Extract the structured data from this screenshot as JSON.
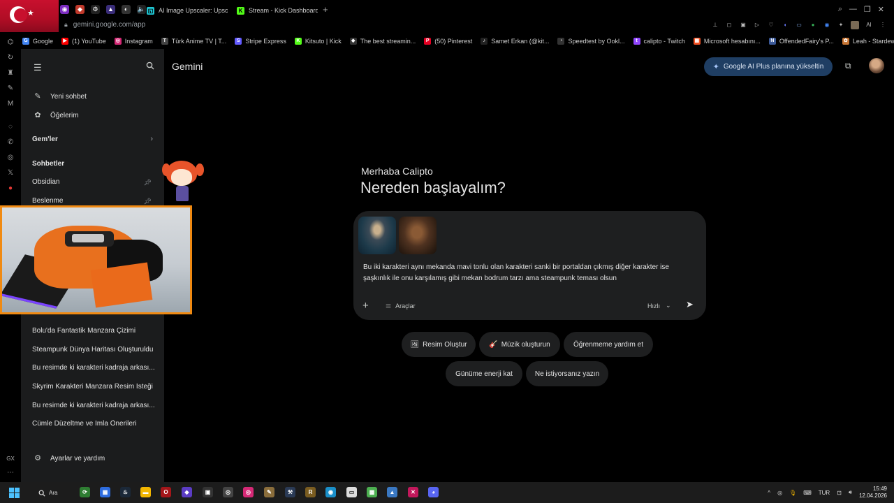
{
  "browser": {
    "tabs": [
      {
        "label": "AI Image Upscaler: Upsca",
        "color": "#1fc7d4"
      },
      {
        "label": "Stream - Kick Dashboard",
        "color": "#53fc18"
      }
    ],
    "url": "gemini.google.com/app",
    "bookmarks": [
      {
        "label": "Google",
        "icon": "G",
        "color": "#4285f4"
      },
      {
        "label": "(1) YouTube",
        "icon": "▶",
        "color": "#ff0000"
      },
      {
        "label": "Instagram",
        "icon": "◎",
        "color": "#d62976"
      },
      {
        "label": "Türk Anime TV | T...",
        "icon": "T",
        "color": "#444444"
      },
      {
        "label": "Stripe Express",
        "icon": "S",
        "color": "#635bff"
      },
      {
        "label": "Kitsuto | Kick",
        "icon": "K",
        "color": "#53fc18"
      },
      {
        "label": "The best streamin...",
        "icon": "◆",
        "color": "#333333"
      },
      {
        "label": "(50) Pinterest",
        "icon": "P",
        "color": "#e60023"
      },
      {
        "label": "Samet Erkan (@kit...",
        "icon": "♪",
        "color": "#222222"
      },
      {
        "label": "Speedtest by Ookl...",
        "icon": "◔",
        "color": "#333333"
      },
      {
        "label": "calipto - Twitch",
        "icon": "t",
        "color": "#9146ff"
      },
      {
        "label": "Microsoft hesabını...",
        "icon": "▦",
        "color": "#f25022"
      },
      {
        "label": "OffendedFairy's P...",
        "icon": "N",
        "color": "#3b5998"
      },
      {
        "label": "Leah - Stardew Va...",
        "icon": "✿",
        "color": "#c87533"
      }
    ]
  },
  "sidebar": {
    "new_chat": "Yeni sohbet",
    "my_items": "Öğelerim",
    "gems_heading": "Gem'ler",
    "chats_heading": "Sohbetler",
    "pinned": [
      "Obsidian",
      "Beslenme"
    ],
    "chats": [
      "Bolu'da Fantastik Manzara Çizimi",
      "Steampunk Dünya Haritası Oluşturuldu",
      "Bu resimde ki karakteri kadraja arkası...",
      "Skyrim Karakteri Manzara Resim İsteği",
      "Bu resimde ki karakteri kadraja arkası...",
      "Cümle Düzeltme ve İmla Önerileri"
    ],
    "settings": "Ayarlar ve yardım"
  },
  "header": {
    "title": "Gemini",
    "upgrade_label": "Google AI Plus planına yükseltin"
  },
  "main": {
    "greeting": "Merhaba Calipto",
    "headline": "Nereden başlayalım?",
    "prompt_text": "Bu iki karakteri aynı mekanda mavi tonlu olan karakteri sanki bir portaldan çıkmış diğer karakter ise şaşkınlık ile onu karşılamış gibi mekan bodrum tarzı ama steampunk teması olsun",
    "tools_label": "Araçlar",
    "speed_label": "Hızlı",
    "chips": [
      {
        "label": "Resim Oluştur",
        "emoji": "🖼"
      },
      {
        "label": "Müzik oluşturun",
        "emoji": "🎸"
      },
      {
        "label": "Öğrenmeme yardım et",
        "emoji": ""
      },
      {
        "label": "Günüme enerji kat",
        "emoji": ""
      },
      {
        "label": "Ne istiyorsanız yazın",
        "emoji": ""
      }
    ]
  },
  "taskbar": {
    "search_label": "Ara",
    "language": "TUR",
    "time": "15:49",
    "date": "12.04.2026"
  },
  "gx_label": "GX"
}
